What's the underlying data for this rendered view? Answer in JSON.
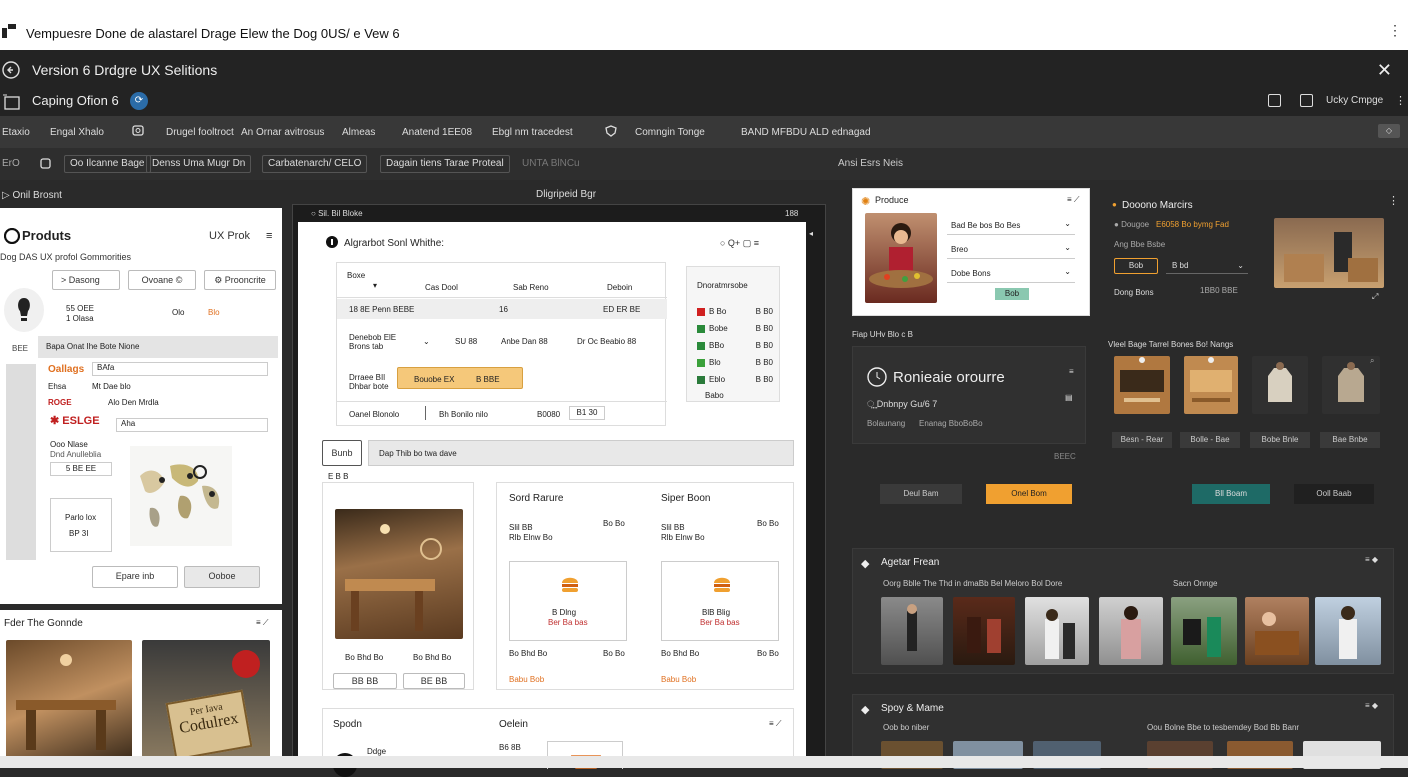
{
  "window": {
    "title": "Vempuesre Done de alastarel Drage Elew the Dog 0US/ e Vew 6",
    "app_title": "Version 6 Drdgre UX Selitions",
    "subtitle": "Caping Ofion 6",
    "account": "Ucky Cmpge"
  },
  "toolbar": {
    "items": [
      "Etaxio",
      "Engal Xhalo",
      "Drugel fooltroct",
      "An Ornar avitrosus",
      "Almeas",
      "Anatend 1EE08",
      "Ebgl nm tracedest",
      "Comngin Tonge",
      "BAND MFBDU ALD ednagad"
    ]
  },
  "toolbar2": {
    "items": [
      "ErO",
      "Oo Ilcanne Bage",
      "Denss Uma Mugr Dn",
      "Carbatenarch/",
      "CELO",
      "Dagain tiens Tarae Proteal",
      "UNTA BlNCu"
    ],
    "right": "Ansi Esrs Neis"
  },
  "subbar": {
    "left": "Onil Brosnt",
    "center": "Dligripeid Bgr"
  },
  "left_panel": {
    "title": "Produts",
    "tag": "UX Prok",
    "subtitle": "Dog DAS UX profol Gommorities",
    "chips": [
      "Dasong",
      "Ovoane",
      "Prooncrite"
    ],
    "small_info": [
      "55 OEE",
      "1 Olasa"
    ],
    "small_vals": [
      "Olo",
      "Blo"
    ],
    "side_label": "BEE",
    "section": "Bapa Onat Ihe Bote Nione",
    "fields": [
      {
        "label": "Oallags",
        "val": "BAfa"
      },
      {
        "label": "Ehsa",
        "val": "Mt Dae blo"
      },
      {
        "label": "ROGE",
        "val": "Alo Den Mrdla"
      },
      {
        "label": "ESLGE",
        "val": "Aha"
      }
    ],
    "map_label": "Ooo Nlase",
    "map_sub": "Dnd Anulleblia",
    "map_val": "5 BE EE",
    "box": [
      "Parlo lox",
      "BP 3I"
    ],
    "buttons": [
      "Epare inb",
      "Ooboe"
    ],
    "bottom_title": "Fder The Gonnde",
    "bottom_sign": "Codulrex",
    "bottom_sign_top": "Per Iava"
  },
  "mid_panel": {
    "header": "Sil. Bil Bloke",
    "header_right": "188",
    "title": "Algrarbot Sonl Whithe:",
    "table_head": [
      "Boxe",
      "Cas Dool",
      "Sab Reno",
      "Deboin"
    ],
    "rows": [
      [
        "18 8E Penn BEBE",
        "16",
        "ED ER BE"
      ],
      [
        "Denebob ElE Brons tab",
        "SU 88",
        "Anbe Dan 88",
        "Dr Oc Beabio 88"
      ],
      [
        "Drraee BIl Dhbar bote",
        "Bouobe EX",
        "B BBE"
      ],
      [
        "Oanel Blonolo",
        "Bh Bonilo nilo",
        "B0080",
        "B1 30"
      ]
    ],
    "sidebar_head": "Dnoratmrsobe",
    "sidebar_rows": [
      [
        "B Bo",
        "B B0"
      ],
      [
        "Bobe",
        "B B0"
      ],
      [
        "BBo",
        "B B0"
      ],
      [
        "Blo",
        "B B0"
      ],
      [
        "Eblo",
        "B B0"
      ]
    ],
    "sidebar_foot": "Babo",
    "search_btn": "Bunb",
    "search_ph": "Dap Thib bo twa dave",
    "count": "E B B",
    "card1": "Sord Rarure",
    "card2": "Siper Boon",
    "card_sub": "Slil BB",
    "card_sub2": "Rlb Elnw Bo",
    "card_price": "Bo Bo",
    "prod1": "B Dlng",
    "prod2": "BlB Blig",
    "prod_sub": "Ber Ba bas",
    "card_foot": "Bo Bhd Bo",
    "card_link": "Babu Bob",
    "btns": [
      "BB BB",
      "BE BB"
    ],
    "bottom1": "Spodn",
    "bottom2": "Oelein",
    "bottom_sub": "Ddge",
    "bottom_num": "B6 8B"
  },
  "right_top": {
    "card_title": "Produce",
    "card_fields": [
      "Bad Be bos Bo Bes",
      "Breo",
      "Dobe Bons"
    ],
    "card_btn": "Bob",
    "right_title": "Dooono Marcirs",
    "right_sub": "Dougoe",
    "right_price": "E6058 Bo bymg Fad",
    "right_label": "Ang Bbe Bsbe",
    "right_btn": "Bob",
    "right_val": "B bd",
    "right_foot": "Dong Bons",
    "right_foot_val": "1BB0 BBE"
  },
  "right_mid": {
    "label": "Fiap UHv Blo c B",
    "title": "Ronieaie orourre",
    "sub": "Dnbnpy Gu/6 7",
    "info": [
      "Bolaunang",
      "Enanag Bbo",
      "BoBo"
    ],
    "foot": "BEEC",
    "cat_label": "Vleel Bage Tarrel Bones Bo! Nangs",
    "cats": [
      "Besn - Rear",
      "Bolle - Bae",
      "Bobe Bnle",
      "Bae Bnbe"
    ],
    "buttons": [
      "Deul Bam",
      "Onel Bom",
      "Bll Boam",
      "Ooll Baab"
    ]
  },
  "right_bottom": {
    "sec1": "Agetar Frean",
    "sec1_sub": "Oorg Bblle The Thd in dmaBb Bel Meloro Bol Dore",
    "sec1_right": "Sacn Onnge",
    "sec2": "Spoy & Mame",
    "sec2_sub": "Oob bo niber",
    "sec2_right": "Oou Bolne Bbe to tesbemdey Bod Bb Banr"
  }
}
